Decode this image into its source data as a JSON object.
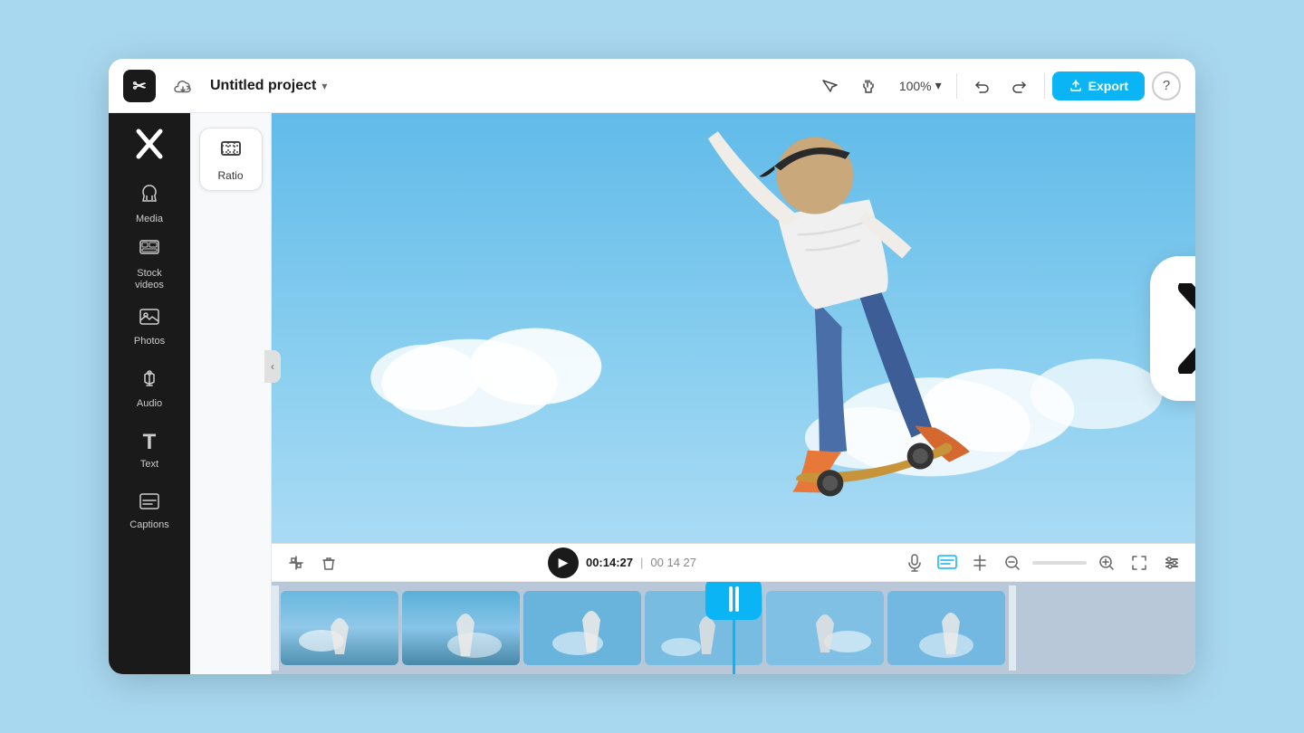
{
  "header": {
    "project_name": "Untitled project",
    "zoom_level": "100%",
    "export_label": "Export",
    "help_label": "?"
  },
  "sidebar": {
    "items": [
      {
        "id": "media",
        "label": "Media",
        "icon": "☁"
      },
      {
        "id": "stock-videos",
        "label": "Stock\nvideos",
        "icon": "⊞"
      },
      {
        "id": "photos",
        "label": "Photos",
        "icon": "🖼"
      },
      {
        "id": "audio",
        "label": "Audio",
        "icon": "♪"
      },
      {
        "id": "text",
        "label": "Text",
        "icon": "T"
      },
      {
        "id": "captions",
        "label": "Captions",
        "icon": "⊟"
      }
    ]
  },
  "tools_panel": {
    "ratio_label": "Ratio"
  },
  "timeline": {
    "current_time": "00:14:27",
    "total_time": "00 14 27",
    "play_icon": "▶"
  },
  "capcut_logo": {
    "brand": "CapCut"
  },
  "colors": {
    "accent": "#0ab4f5",
    "sidebar_bg": "#1a1a1a",
    "header_bg": "#ffffff",
    "playhead_color": "#0ab4f5"
  }
}
